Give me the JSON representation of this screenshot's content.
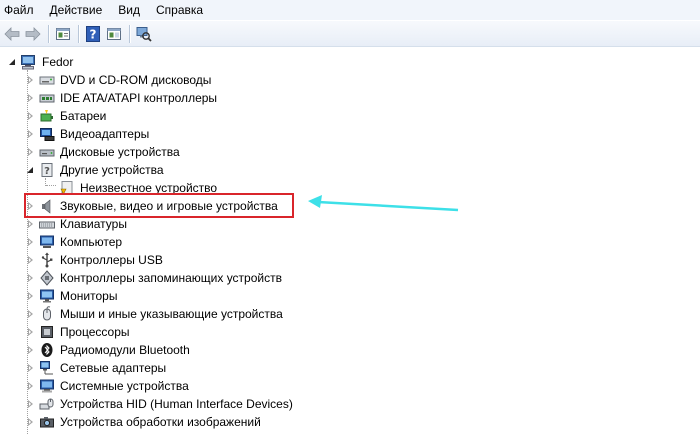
{
  "menu": {
    "items": [
      "Файл",
      "Действие",
      "Вид",
      "Справка"
    ]
  },
  "toolbar": {
    "buttons": [
      "back-icon",
      "forward-icon",
      "properties-icon",
      "help-icon",
      "show-hide-icon",
      "scan-hardware-icon"
    ]
  },
  "tree": {
    "root": "Fedor",
    "items": [
      {
        "label": "DVD и CD-ROM дисководы",
        "icon": "dvd-drive-icon"
      },
      {
        "label": "IDE ATA/ATAPI контроллеры",
        "icon": "ide-controller-icon"
      },
      {
        "label": "Батареи",
        "icon": "battery-icon"
      },
      {
        "label": "Видеоадаптеры",
        "icon": "display-adapter-icon"
      },
      {
        "label": "Дисковые устройства",
        "icon": "disk-drive-icon"
      },
      {
        "label": "Другие устройства",
        "icon": "other-devices-icon"
      },
      {
        "label": "Неизвестное устройство",
        "icon": "unknown-device-icon"
      },
      {
        "label": "Звуковые, видео и игровые устройства",
        "icon": "speaker-icon"
      },
      {
        "label": "Клавиатуры",
        "icon": "keyboard-icon"
      },
      {
        "label": "Компьютер",
        "icon": "computer-icon"
      },
      {
        "label": "Контроллеры USB",
        "icon": "usb-icon"
      },
      {
        "label": "Контроллеры запоминающих устройств",
        "icon": "storage-controller-icon"
      },
      {
        "label": "Мониторы",
        "icon": "monitor-icon"
      },
      {
        "label": "Мыши и иные указывающие устройства",
        "icon": "mouse-icon"
      },
      {
        "label": "Процессоры",
        "icon": "processor-icon"
      },
      {
        "label": "Радиомодули Bluetooth",
        "icon": "bluetooth-icon"
      },
      {
        "label": "Сетевые адаптеры",
        "icon": "network-adapter-icon"
      },
      {
        "label": "Системные устройства",
        "icon": "system-devices-icon"
      },
      {
        "label": "Устройства HID (Human Interface Devices)",
        "icon": "hid-icon"
      },
      {
        "label": "Устройства обработки изображений",
        "icon": "imaging-device-icon"
      }
    ]
  },
  "colors": {
    "highlight_box": "#d9252b",
    "annotation_arrow": "#3de0e8"
  }
}
